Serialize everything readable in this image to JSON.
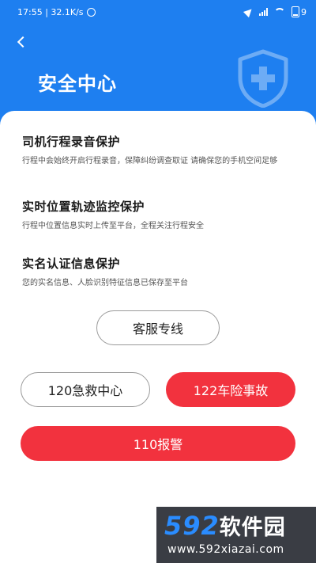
{
  "status_bar": {
    "time_speed": "17:55 | 32.1K/s",
    "battery": "9"
  },
  "header": {
    "title": "安全中心"
  },
  "sections": [
    {
      "title": "司机行程录音保护",
      "desc": "行程中会始终开启行程录音，保障纠纷调查取证 请确保您的手机空间足够"
    },
    {
      "title": "实时位置轨迹监控保护",
      "desc": "行程中位置信息实时上传至平台，全程关注行程安全"
    },
    {
      "title": "实名认证信息保护",
      "desc": "您的实名信息、人脸识别特征信息已保存至平台"
    }
  ],
  "buttons": {
    "service": "客服专线",
    "emergency_120": "120急救中心",
    "accident_122": "122车险事故",
    "police_110": "110报警"
  },
  "watermark": {
    "logo_num": "592",
    "logo_text": "软件园",
    "url": "www.592xiazai.com"
  },
  "colors": {
    "primary": "#1e7ff0",
    "danger": "#f2323e"
  },
  "icons": [
    "back-icon",
    "shield-plus-icon",
    "alarm-icon",
    "location-icon",
    "signal-icon",
    "wifi-icon",
    "battery-icon"
  ]
}
